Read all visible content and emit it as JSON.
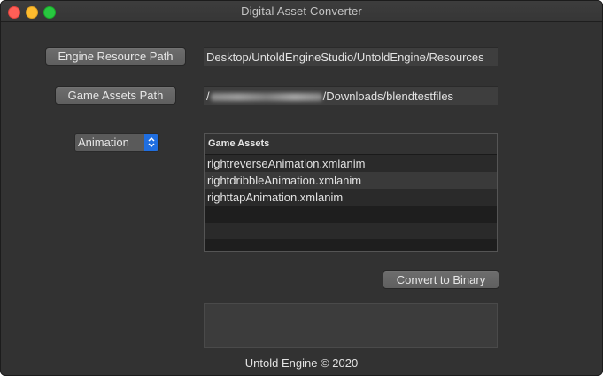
{
  "window": {
    "title": "Digital Asset Converter"
  },
  "engine": {
    "button_label": "Engine Resource Path",
    "path": "Desktop/UntoldEngineStudio/UntoldEngine/Resources"
  },
  "game": {
    "button_label": "Game Assets Path",
    "path_prefix": "/",
    "path_suffix": "/Downloads/blendtestfiles"
  },
  "asset_type": {
    "selected": "Animation"
  },
  "table": {
    "header": "Game Assets",
    "rows": [
      "rightreverseAnimation.xmlanim",
      "rightdribbleAnimation.xmlanim",
      "righttapAnimation.xmlanim",
      "",
      "",
      ""
    ]
  },
  "convert": {
    "button_label": "Convert to Binary"
  },
  "output": {
    "text": ""
  },
  "footer": {
    "text": "Untold Engine © 2020"
  }
}
